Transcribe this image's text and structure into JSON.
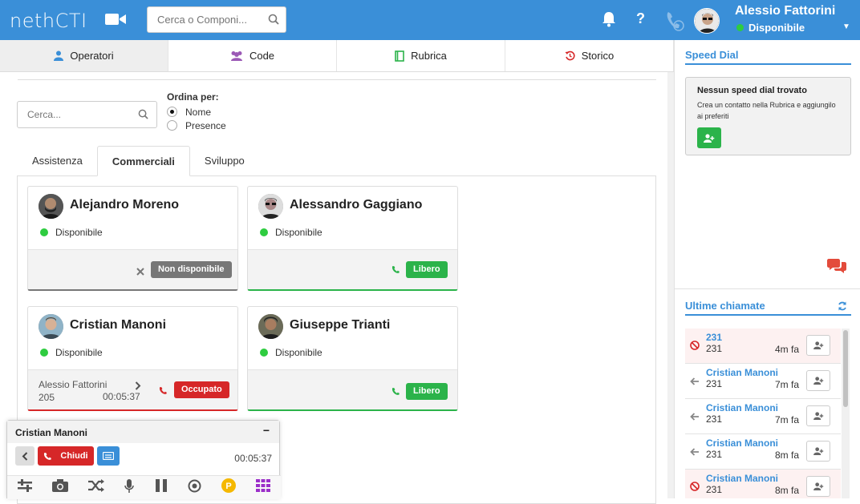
{
  "topbar": {
    "logo_main": "neth",
    "logo_cti": "CTI",
    "search_placeholder": "Cerca o Componi...",
    "user_name": "Alessio Fattorini",
    "user_status": "Disponibile",
    "help_label": "?"
  },
  "tabs": [
    {
      "label": "Operatori",
      "icon": "user-icon"
    },
    {
      "label": "Code",
      "icon": "users-icon"
    },
    {
      "label": "Rubrica",
      "icon": "book-icon"
    },
    {
      "label": "Storico",
      "icon": "history-icon"
    }
  ],
  "operators": {
    "search_placeholder": "Cerca...",
    "order_label": "Ordina per:",
    "order_options": [
      "Nome",
      "Presence"
    ],
    "order_selected": "Nome",
    "groups": [
      "Assistenza",
      "Commerciali",
      "Sviluppo"
    ],
    "active_group": "Commerciali",
    "cards": [
      {
        "name": "Alejandro Moreno",
        "status": "Disponibile",
        "badge": "Non disponibile"
      },
      {
        "name": "Alessandro Gaggiano",
        "status": "Disponibile",
        "badge": "Libero"
      },
      {
        "name": "Cristian Manoni",
        "status": "Disponibile",
        "badge": "Occupato",
        "call_with": "Alessio Fattorini",
        "call_number": "205",
        "call_duration": "00:05:37"
      },
      {
        "name": "Giuseppe Trianti",
        "status": "Disponibile",
        "badge": "Libero"
      }
    ]
  },
  "callbox": {
    "name": "Cristian Manoni",
    "minimize": "−",
    "hangup_label": "Chiudi",
    "duration": "00:05:37",
    "parking_label": "P"
  },
  "speed_dial": {
    "title": "Speed Dial",
    "empty_title": "Nessun speed dial trovato",
    "empty_text": "Crea un contatto nella Rubrica e aggiungilo ai preferiti"
  },
  "recent_calls": {
    "title": "Ultime chiamate",
    "items": [
      {
        "name": "231",
        "number": "231",
        "time": "4m fa",
        "type": "missed"
      },
      {
        "name": "Cristian Manoni",
        "number": "231",
        "time": "7m fa",
        "type": "incoming"
      },
      {
        "name": "Cristian Manoni",
        "number": "231",
        "time": "7m fa",
        "type": "incoming"
      },
      {
        "name": "Cristian Manoni",
        "number": "231",
        "time": "8m fa",
        "type": "incoming"
      },
      {
        "name": "Cristian Manoni",
        "number": "231",
        "time": "8m fa",
        "type": "missed"
      }
    ]
  },
  "colors": {
    "brand": "#3a8fd8",
    "available": "#2ecc40",
    "free": "#2bb34a",
    "busy": "#d62728",
    "unavailable": "#777777"
  }
}
